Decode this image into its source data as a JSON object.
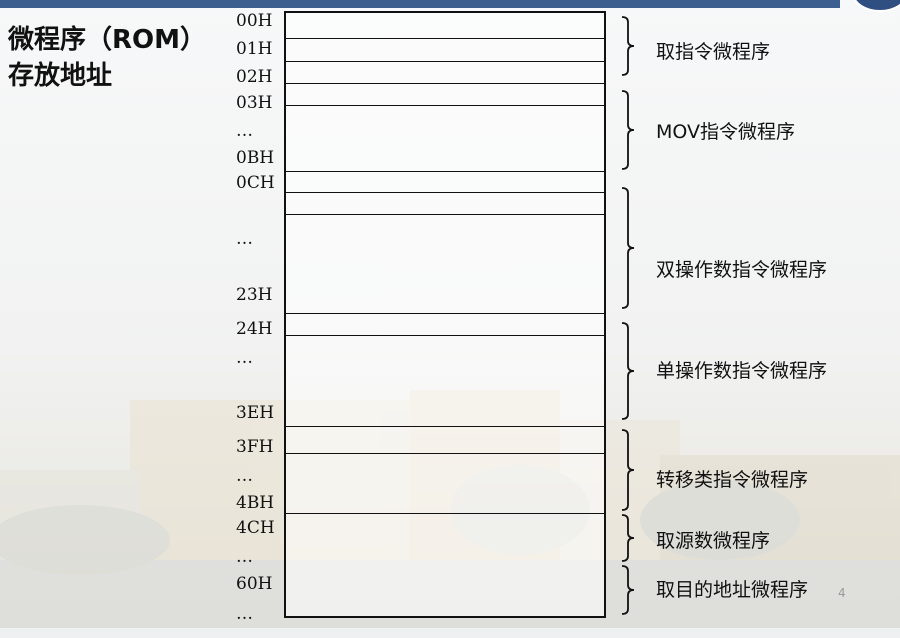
{
  "title": {
    "line1": "微程序（ROM）",
    "line2": "存放地址"
  },
  "addresses": [
    "00H",
    "01H",
    "02H",
    "03H",
    "…",
    "0BH",
    "0CH",
    "…",
    "23H",
    "24H",
    "…",
    "3EH",
    "3FH",
    "…",
    "4BH",
    "4CH",
    "…",
    "60H",
    "…"
  ],
  "segments": [
    {
      "label": "取指令微程序"
    },
    {
      "label": "MOV指令微程序"
    },
    {
      "label": "双操作数指令微程序"
    },
    {
      "label": "单操作数指令微程序"
    },
    {
      "label": "转移类指令微程序"
    },
    {
      "label": "取源数微程序"
    },
    {
      "label": "取目的地址微程序"
    }
  ],
  "page_number": "4",
  "colors": {
    "top_bar": "#3d5f8f",
    "line": "#111111"
  }
}
